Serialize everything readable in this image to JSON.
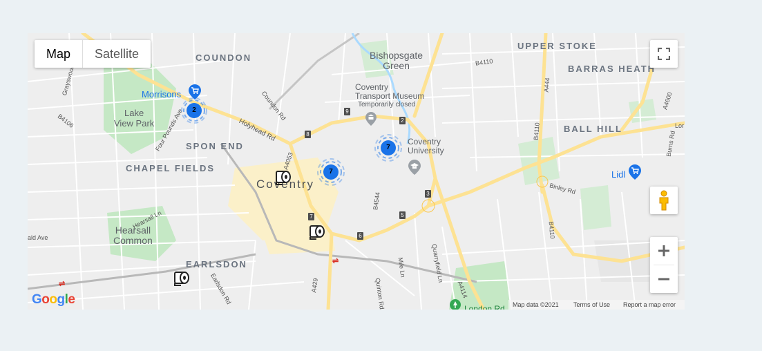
{
  "map_type": {
    "map_label": "Map",
    "satellite_label": "Satellite"
  },
  "labels": {
    "coundon": "COUNDON",
    "upper_stoke": "UPPER STOKE",
    "barras_heath": "BARRAS HEATH",
    "bishopsgate_1": "Bishopsgate",
    "bishopsgate_2": "Green",
    "lake_1": "Lake",
    "lake_2": "View Park",
    "spon_end": "SPON END",
    "chapel_fields": "CHAPEL FIELDS",
    "coventry": "Coventry",
    "ball_hill": "BALL HILL",
    "hearsall_1": "Hearsall",
    "hearsall_2": "Common",
    "earlsdon": "EARLSDON",
    "museum_1": "Coventry",
    "museum_2": "Transport Museum",
    "temporarily_closed": "Temporarily closed",
    "uni_1": "Coventry",
    "uni_2": "University",
    "morrisons": "Morrisons",
    "lidl": "Lidl",
    "london_rd": "London Rd"
  },
  "roads": {
    "b4110_top": "B4110",
    "holyhead": "Holyhead Rd",
    "coundon_rd": "Coundon Rd",
    "a4053": "A4053",
    "four_pounds": "Four Pounds Ave",
    "b4106": "B4106",
    "a444": "A444",
    "b4110_right": "B4110",
    "a4600": "A4600",
    "burns": "Burns Rd",
    "binley": "Binley Rd",
    "b4110_lower": "B4110",
    "b4544": "B4544",
    "a429": "A429",
    "a4114": "A4114",
    "quinton": "Quinton Rd",
    "mile_ln": "Mile Ln",
    "quarryfield": "Quarryfield Ln",
    "hearsall_ln": "Hearsall Ln",
    "earlsdon_rd": "Earlsdon Rd",
    "grays": "Grayswood",
    "ald_ave": "ald Ave",
    "lor": "Lor"
  },
  "junctions": [
    "9",
    "8",
    "2",
    "3",
    "5",
    "6",
    "7"
  ],
  "clusters": [
    {
      "count": "2"
    },
    {
      "count": "7"
    },
    {
      "count": "7"
    }
  ],
  "markers": [
    "toilet-roll-marker",
    "toilet-roll-marker",
    "toilet-roll-marker"
  ],
  "footer": {
    "google": "Google",
    "map_data": "Map data ©2021",
    "terms": "Terms of Use",
    "report": "Report a map error"
  },
  "colors": {
    "page_bg": "#ebf1f4",
    "map_bg": "#eeeeee",
    "park": "#c5e8c5",
    "major_road": "#fde293",
    "cluster": "#1a73e8"
  },
  "icons": [
    "fullscreen-icon",
    "pegman-icon",
    "zoom-in-icon",
    "zoom-out-icon",
    "shopping-cart-icon",
    "museum-icon",
    "university-icon",
    "train-station-icon",
    "google-logo"
  ]
}
